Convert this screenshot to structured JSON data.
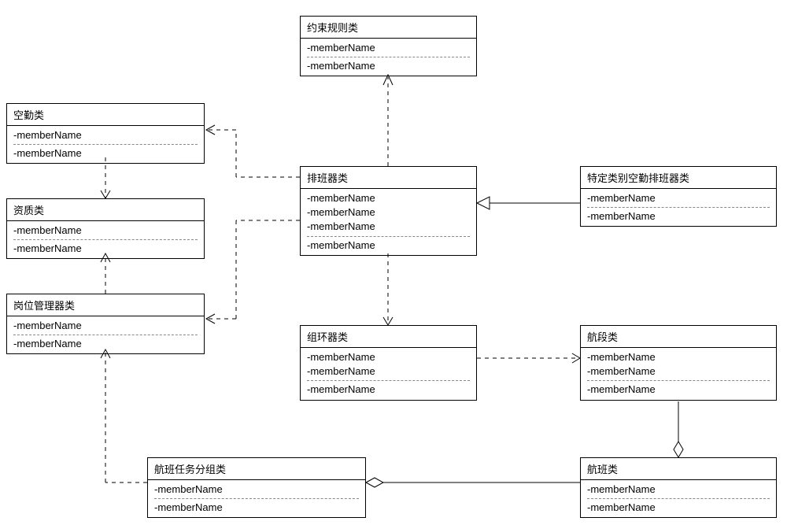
{
  "chart_data": {
    "type": "diagram",
    "diagram_type": "uml_class",
    "classes": [
      {
        "id": "constraint",
        "name": "约束规则类",
        "members": [
          "-memberName",
          "-memberName"
        ]
      },
      {
        "id": "aircrew",
        "name": "空勤类",
        "members": [
          "-memberName",
          "-memberName"
        ]
      },
      {
        "id": "qualification",
        "name": "资质类",
        "members": [
          "-memberName",
          "-memberName"
        ]
      },
      {
        "id": "position_mgr",
        "name": "岗位管理器类",
        "members": [
          "-memberName",
          "-memberName"
        ]
      },
      {
        "id": "scheduler",
        "name": "排班器类",
        "members": [
          "-memberName",
          "-memberName",
          "-memberName",
          "-memberName"
        ]
      },
      {
        "id": "specific_scheduler",
        "name": "特定类别空勤排班器类",
        "members": [
          "-memberName",
          "-memberName"
        ]
      },
      {
        "id": "loop",
        "name": "组环器类",
        "members": [
          "-memberName",
          "-memberName",
          "-memberName"
        ]
      },
      {
        "id": "segment",
        "name": "航段类",
        "members": [
          "-memberName",
          "-memberName",
          "-memberName"
        ]
      },
      {
        "id": "taskgroup",
        "name": "航班任务分组类",
        "members": [
          "-memberName",
          "-memberName"
        ]
      },
      {
        "id": "flight",
        "name": "航班类",
        "members": [
          "-memberName",
          "-memberName"
        ]
      }
    ],
    "relations": [
      {
        "from": "scheduler",
        "to": "constraint",
        "type": "dependency"
      },
      {
        "from": "scheduler",
        "to": "aircrew",
        "type": "dependency"
      },
      {
        "from": "aircrew",
        "to": "qualification",
        "type": "dependency"
      },
      {
        "from": "position_mgr",
        "to": "qualification",
        "type": "dependency"
      },
      {
        "from": "specific_scheduler",
        "to": "scheduler",
        "type": "generalization"
      },
      {
        "from": "scheduler",
        "to": "loop",
        "type": "dependency"
      },
      {
        "from": "loop",
        "to": "segment",
        "type": "dependency"
      },
      {
        "from": "flight",
        "to": "segment",
        "type": "aggregation"
      },
      {
        "from": "taskgroup",
        "to": "flight",
        "type": "aggregation"
      },
      {
        "from": "taskgroup",
        "to": "position_mgr",
        "type": "dependency"
      },
      {
        "from": "scheduler",
        "to": "position_mgr",
        "type": "dependency"
      }
    ]
  },
  "classes": {
    "constraint": {
      "title": "约束规则类",
      "m0": "-memberName",
      "m1": "-memberName"
    },
    "aircrew": {
      "title": "空勤类",
      "m0": "-memberName",
      "m1": "-memberName"
    },
    "qualification": {
      "title": "资质类",
      "m0": "-memberName",
      "m1": "-memberName"
    },
    "position_mgr": {
      "title": "岗位管理器类",
      "m0": "-memberName",
      "m1": "-memberName"
    },
    "scheduler": {
      "title": "排班器类",
      "m0": "-memberName",
      "m1": "-memberName",
      "m2": "-memberName",
      "m3": "-memberName"
    },
    "specific_scheduler": {
      "title": "特定类别空勤排班器类",
      "m0": "-memberName",
      "m1": "-memberName"
    },
    "loop": {
      "title": "组环器类",
      "m0": "-memberName",
      "m1": "-memberName",
      "m2": "-memberName"
    },
    "segment": {
      "title": "航段类",
      "m0": "-memberName",
      "m1": "-memberName",
      "m2": "-memberName"
    },
    "taskgroup": {
      "title": "航班任务分组类",
      "m0": "-memberName",
      "m1": "-memberName"
    },
    "flight": {
      "title": "航班类",
      "m0": "-memberName",
      "m1": "-memberName"
    }
  }
}
